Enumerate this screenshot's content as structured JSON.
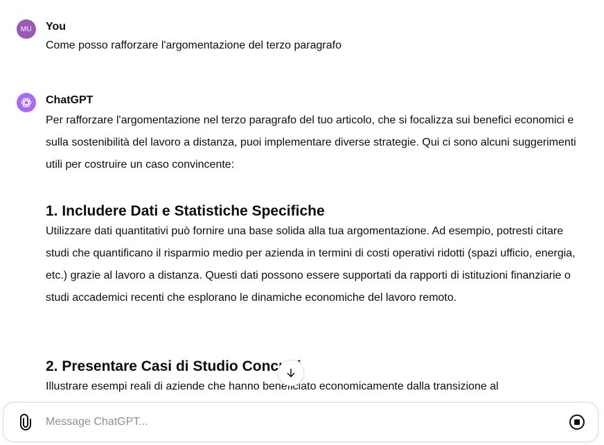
{
  "conversation": {
    "user": {
      "avatar_initials": "MU",
      "name": "You",
      "message": "Come posso rafforzare l'argomentazione del terzo paragrafo"
    },
    "assistant": {
      "name": "ChatGPT",
      "intro": "Per rafforzare l'argomentazione nel terzo paragrafo del tuo articolo, che si focalizza sui benefici economici e sulla sostenibilità del lavoro a distanza, puoi implementare diverse strategie. Qui ci sono alcuni suggerimenti utili per costruire un caso convincente:",
      "section1_heading": "1. Includere Dati e Statistiche Specifiche",
      "section1_text": "Utilizzare dati quantitativi può fornire una base solida alla tua argomentazione. Ad esempio, potresti citare studi che quantificano il risparmio medio per azienda in termini di costi operativi ridotti (spazi ufficio, energia, etc.) grazie al lavoro a distanza. Questi dati possono essere supportati da rapporti di istituzioni finanziarie o studi accademici recenti che esplorano le dinamiche economiche del lavoro remoto.",
      "section2_heading": "2. Presentare Casi di Studio Concreti",
      "section2_text": "Illustrare esempi reali di aziende che hanno beneficiato economicamente dalla transizione al"
    }
  },
  "composer": {
    "placeholder": "Message ChatGPT..."
  },
  "icons": {
    "user_avatar": "user-avatar",
    "assistant_avatar": "openai-logo-icon",
    "scroll": "arrow-down-icon",
    "attach": "paperclip-icon",
    "stop": "stop-icon"
  },
  "colors": {
    "user_avatar": "#9b59b6",
    "assistant_avatar": "#ab68ff",
    "placeholder": "#8e8ea0"
  }
}
